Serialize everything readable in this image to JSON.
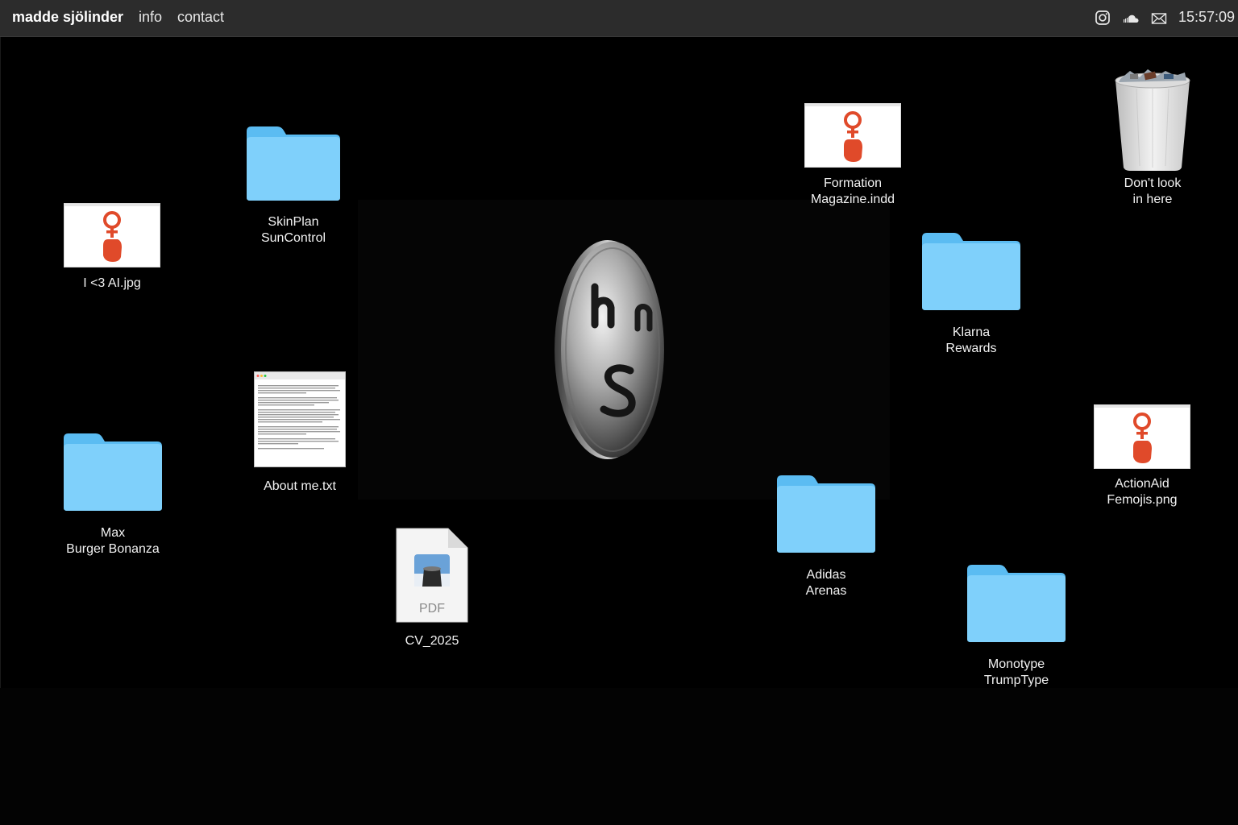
{
  "menubar": {
    "brand": "madde sjölinder",
    "info": "info",
    "contact": "contact",
    "icons": [
      "instagram-icon",
      "soundcloud-icon",
      "mail-icon"
    ],
    "clock": "15:57:09"
  },
  "desktop": {
    "items": {
      "skinplan": {
        "line1": "SkinPlan",
        "line2": "SunControl"
      },
      "ai_jpg": {
        "line1": "I <3 AI.jpg"
      },
      "max": {
        "line1": "Max",
        "line2": "Burger Bonanza"
      },
      "about": {
        "line1": "About me.txt"
      },
      "cv": {
        "line1": "CV_2025",
        "badge": "PDF"
      },
      "formation": {
        "line1": "Formation",
        "line2": "Magazine.indd"
      },
      "trash": {
        "line1": "Don't look",
        "line2": "in here"
      },
      "klarna": {
        "line1": "Klarna",
        "line2": "Rewards"
      },
      "actionaid": {
        "line1": "ActionAid",
        "line2": "Femojis.png"
      },
      "adidas": {
        "line1": "Adidas",
        "line2": "Arenas"
      },
      "monotype": {
        "line1": "Monotype",
        "line2": "TrumpType"
      }
    }
  },
  "colors": {
    "folder_light": "#7fd0fb",
    "folder_dark": "#5bbcf2",
    "femoji_red": "#e04a2a",
    "menubar_bg": "#2c2c2c"
  }
}
